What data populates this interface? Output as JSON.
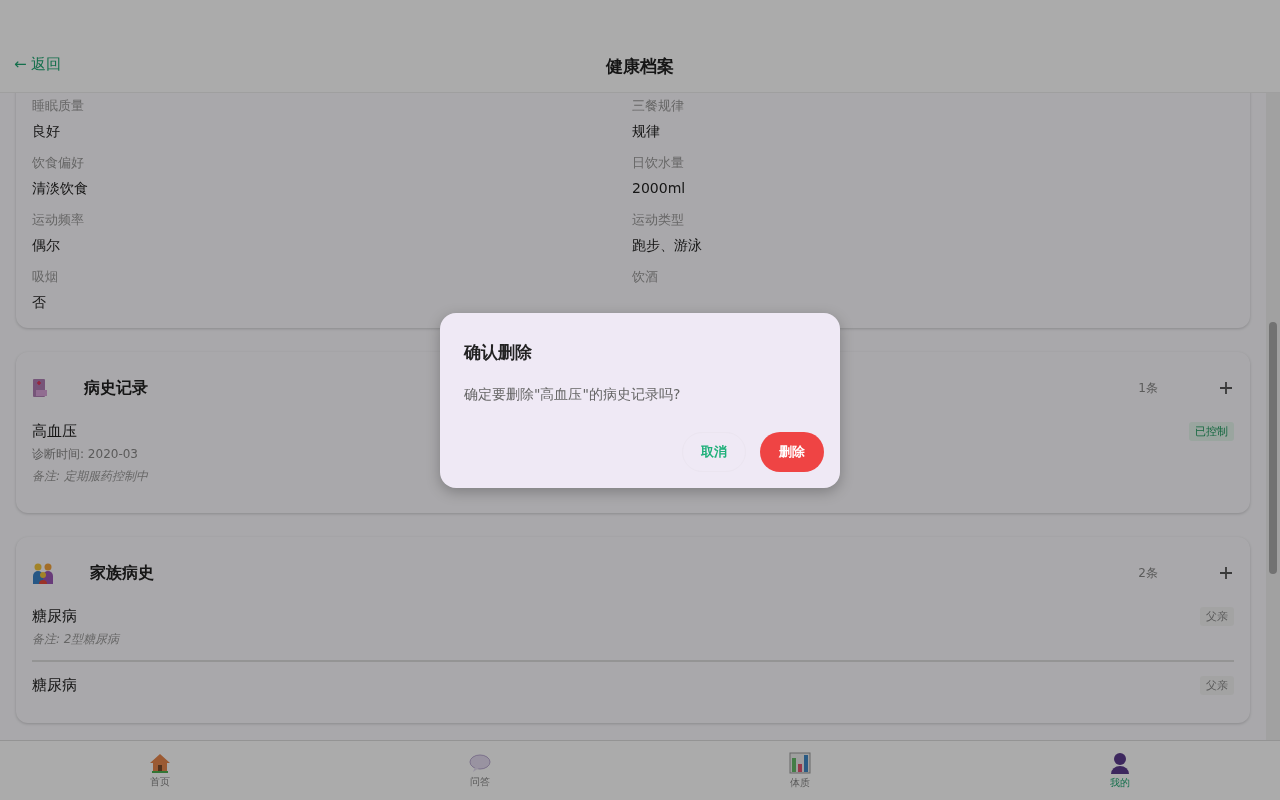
{
  "header": {
    "back": "← 返回",
    "title": "健康档案"
  },
  "lifestyle": [
    {
      "label": "睡眠质量",
      "value": "良好"
    },
    {
      "label": "三餐规律",
      "value": "规律"
    },
    {
      "label": "饮食偏好",
      "value": "清淡饮食"
    },
    {
      "label": "日饮水量",
      "value": "2000ml"
    },
    {
      "label": "运动频率",
      "value": "偶尔"
    },
    {
      "label": "运动类型",
      "value": "跑步、游泳"
    },
    {
      "label": "吸烟",
      "value": "否"
    },
    {
      "label": "饮酒"
    }
  ],
  "medical_history": {
    "title": "病史记录",
    "count": "1条",
    "records": [
      {
        "name": "高血压",
        "diagnosed": "诊断时间: 2020-03",
        "note": "备注: 定期服药控制中",
        "status": "已控制"
      }
    ]
  },
  "family_history": {
    "title": "家族病史",
    "count": "2条",
    "records": [
      {
        "name": "糖尿病",
        "relation": "父亲",
        "note": "备注: 2型糖尿病"
      },
      {
        "name": "糖尿病",
        "relation": "父亲"
      }
    ]
  },
  "dialog": {
    "title": "确认删除",
    "message": "确定要删除\"高血压\"的病史记录吗?",
    "cancel": "取消",
    "confirm": "删除"
  },
  "nav": [
    {
      "label": "首页",
      "kind": "home",
      "selected": false
    },
    {
      "label": "问答",
      "kind": "chat",
      "selected": false
    },
    {
      "label": "体质",
      "kind": "chart",
      "selected": false
    },
    {
      "label": "我的",
      "kind": "user",
      "selected": true
    }
  ]
}
